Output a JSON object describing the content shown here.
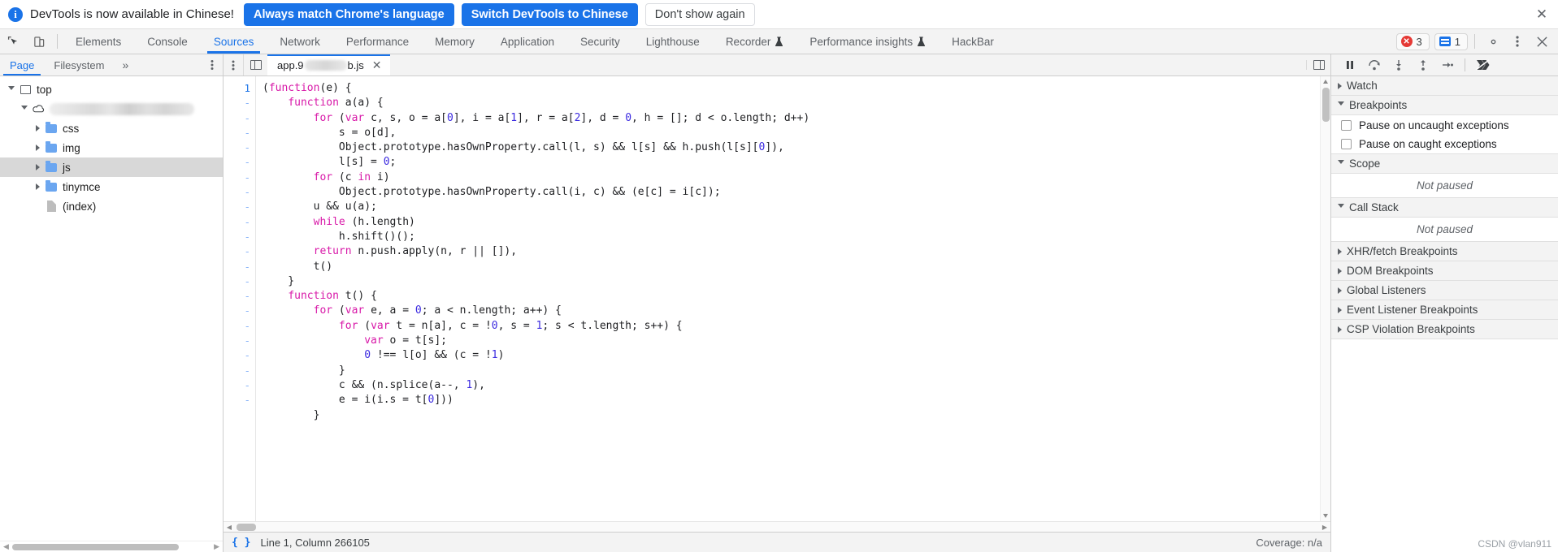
{
  "banner": {
    "icon": "info-icon",
    "message": "DevTools is now available in Chinese!",
    "primary_buttons": [
      "Always match Chrome's language",
      "Switch DevTools to Chinese"
    ],
    "secondary_button": "Don't show again",
    "close": "✕"
  },
  "toolbar": {
    "inspect_icon": "inspect-cursor-icon",
    "device_icon": "device-toggle-icon",
    "tabs": [
      {
        "label": "Elements",
        "active": false,
        "experimental": false
      },
      {
        "label": "Console",
        "active": false,
        "experimental": false
      },
      {
        "label": "Sources",
        "active": true,
        "experimental": false
      },
      {
        "label": "Network",
        "active": false,
        "experimental": false
      },
      {
        "label": "Performance",
        "active": false,
        "experimental": false
      },
      {
        "label": "Memory",
        "active": false,
        "experimental": false
      },
      {
        "label": "Application",
        "active": false,
        "experimental": false
      },
      {
        "label": "Security",
        "active": false,
        "experimental": false
      },
      {
        "label": "Lighthouse",
        "active": false,
        "experimental": false
      },
      {
        "label": "Recorder",
        "active": false,
        "experimental": true
      },
      {
        "label": "Performance insights",
        "active": false,
        "experimental": true
      },
      {
        "label": "HackBar",
        "active": false,
        "experimental": false
      }
    ],
    "error_count": "3",
    "message_count": "1",
    "settings_icon": "gear-icon",
    "kebab_icon": "more-options-icon",
    "close_icon": "close-icon"
  },
  "navigator": {
    "tabs": [
      {
        "label": "Page",
        "active": true
      },
      {
        "label": "Filesystem",
        "active": false
      }
    ],
    "overflow": "»",
    "kebab_icon": "more-options-icon",
    "tree": [
      {
        "label": "top",
        "icon": "frame-icon",
        "depth": 0,
        "expanded": true,
        "selected": false,
        "redacted": false
      },
      {
        "label": "",
        "icon": "cloud-icon",
        "depth": 1,
        "expanded": true,
        "selected": false,
        "redacted": true
      },
      {
        "label": "css",
        "icon": "folder-icon",
        "depth": 2,
        "expanded": false,
        "selected": false,
        "redacted": false
      },
      {
        "label": "img",
        "icon": "folder-icon",
        "depth": 2,
        "expanded": false,
        "selected": false,
        "redacted": false
      },
      {
        "label": "js",
        "icon": "folder-icon",
        "depth": 2,
        "expanded": false,
        "selected": true,
        "redacted": false
      },
      {
        "label": "tinymce",
        "icon": "folder-icon",
        "depth": 2,
        "expanded": false,
        "selected": false,
        "redacted": false
      },
      {
        "label": "(index)",
        "icon": "file-icon",
        "depth": 2,
        "expanded": null,
        "selected": false,
        "redacted": false
      }
    ]
  },
  "editor": {
    "kebab_icon": "more-options-icon",
    "navigator_toggle_icon": "show-navigator-icon",
    "debugger_toggle_icon": "show-debugger-icon",
    "tab_prefix": "app.9",
    "tab_suffix": "b.js",
    "tab_close": "✕",
    "first_line_number": "1",
    "fold_marker": "-",
    "lines": [
      "(function(e) {",
      "    function a(a) {",
      "        for (var c, s, o = a[0], i = a[1], r = a[2], d = 0, h = []; d < o.length; d++)",
      "            s = o[d],",
      "            Object.prototype.hasOwnProperty.call(l, s) && l[s] && h.push(l[s][0]),",
      "            l[s] = 0;",
      "        for (c in i)",
      "            Object.prototype.hasOwnProperty.call(i, c) && (e[c] = i[c]);",
      "        u && u(a);",
      "        while (h.length)",
      "            h.shift()();",
      "        return n.push.apply(n, r || []),",
      "        t()",
      "    }",
      "    function t() {",
      "        for (var e, a = 0; a < n.length; a++) {",
      "            for (var t = n[a], c = !0, s = 1; s < t.length; s++) {",
      "                var o = t[s];",
      "                0 !== l[o] && (c = !1)",
      "            }",
      "            c && (n.splice(a--, 1),",
      "            e = i(i.s = t[0]))",
      "        }"
    ]
  },
  "status": {
    "format_icon": "pretty-print-icon",
    "cursor_position": "Line 1, Column 266105",
    "coverage": "Coverage: n/a"
  },
  "debugger": {
    "buttons": [
      {
        "name": "pause-resume-button",
        "icon": "pause-icon"
      },
      {
        "name": "step-over-button",
        "icon": "step-over-icon"
      },
      {
        "name": "step-into-button",
        "icon": "step-into-icon"
      },
      {
        "name": "step-out-button",
        "icon": "step-out-icon"
      },
      {
        "name": "step-button",
        "icon": "step-icon"
      },
      {
        "name": "deactivate-breakpoints-button",
        "icon": "deactivate-breakpoints-icon"
      }
    ],
    "sections": [
      {
        "label": "Watch",
        "expanded": false,
        "type": "plain"
      },
      {
        "label": "Breakpoints",
        "expanded": true,
        "type": "breakpoints"
      },
      {
        "label": "Scope",
        "expanded": true,
        "type": "status"
      },
      {
        "label": "Call Stack",
        "expanded": true,
        "type": "status"
      },
      {
        "label": "XHR/fetch Breakpoints",
        "expanded": false,
        "type": "plain"
      },
      {
        "label": "DOM Breakpoints",
        "expanded": false,
        "type": "plain"
      },
      {
        "label": "Global Listeners",
        "expanded": false,
        "type": "plain"
      },
      {
        "label": "Event Listener Breakpoints",
        "expanded": false,
        "type": "plain"
      },
      {
        "label": "CSP Violation Breakpoints",
        "expanded": false,
        "type": "plain"
      }
    ],
    "checkboxes": [
      {
        "label": "Pause on uncaught exceptions",
        "checked": false
      },
      {
        "label": "Pause on caught exceptions",
        "checked": false
      }
    ],
    "not_paused_text": "Not paused"
  },
  "watermark": "CSDN @vlan911",
  "colors": {
    "accent": "#1a73e8",
    "error": "#e53935",
    "keyword": "#d818a8",
    "number": "#3b2ae0",
    "toolbar_bg": "#f3f3f3"
  }
}
